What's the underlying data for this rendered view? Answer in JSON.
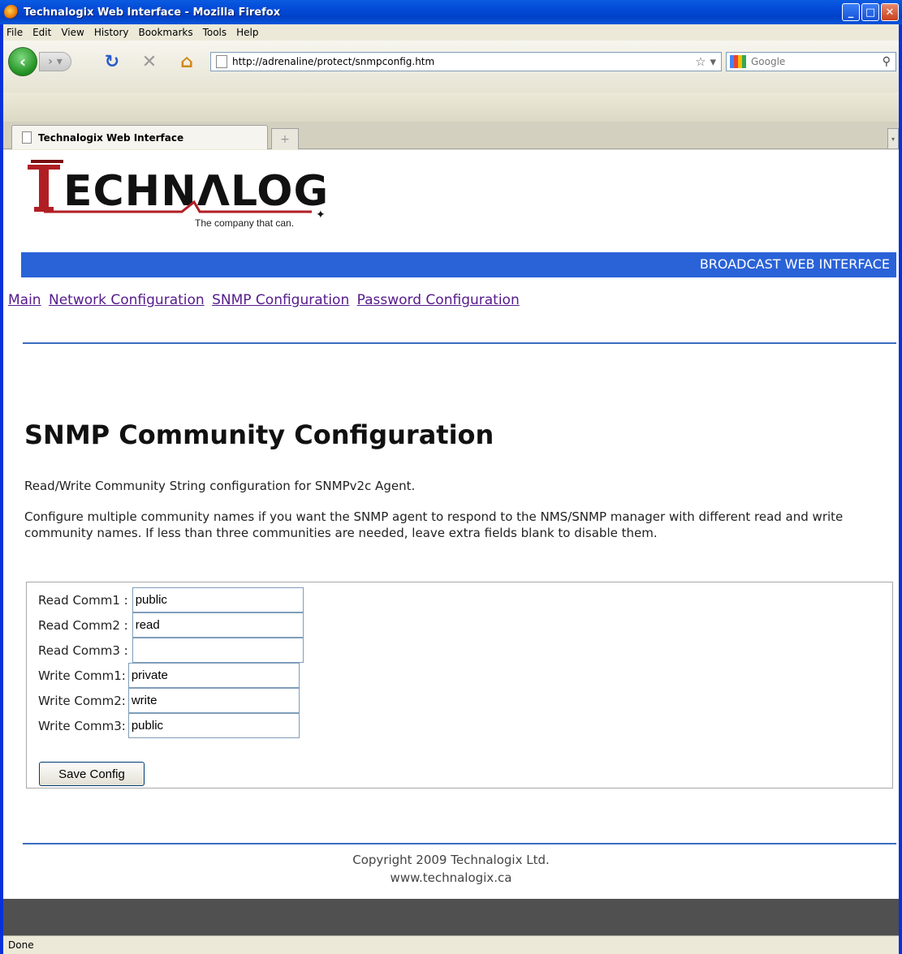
{
  "window": {
    "title": "Technalogix Web Interface - Mozilla Firefox"
  },
  "menu": [
    "File",
    "Edit",
    "View",
    "History",
    "Bookmarks",
    "Tools",
    "Help"
  ],
  "toolbar": {
    "url": "http://adrenaline/protect/snmpconfig.htm",
    "search_placeholder": "Google"
  },
  "tab": {
    "title": "Technalogix Web Interface",
    "new_tab": "+"
  },
  "page": {
    "logo_text": "ECHNALOGIX",
    "logo_tagline": "The company that can.",
    "banner": "BROADCAST WEB INTERFACE",
    "nav": [
      "Main",
      "Network Configuration",
      "SNMP Configuration",
      "Password Configuration"
    ],
    "title": "SNMP Community Configuration",
    "description": "Read/Write Community String configuration for SNMPv2c Agent.",
    "instructions": "Configure multiple community names if you want the SNMP agent to respond to the NMS/SNMP manager with different read and write community names. If less than three communities are needed, leave extra fields blank to disable them.",
    "fields": [
      {
        "label": "Read Comm1 :",
        "value": "public"
      },
      {
        "label": "Read Comm2 :",
        "value": "read"
      },
      {
        "label": "Read Comm3 :",
        "value": ""
      },
      {
        "label": "Write Comm1:",
        "value": "private"
      },
      {
        "label": "Write Comm2:",
        "value": "write"
      },
      {
        "label": "Write Comm3:",
        "value": "public"
      }
    ],
    "save_label": "Save Config",
    "copyright": "Copyright 2009 Technalogix Ltd.",
    "website": "www.technalogix.ca"
  },
  "status": "Done",
  "colors": {
    "banner": "#2a62d8",
    "link": "#551a8b",
    "logo_red": "#b01e23"
  }
}
